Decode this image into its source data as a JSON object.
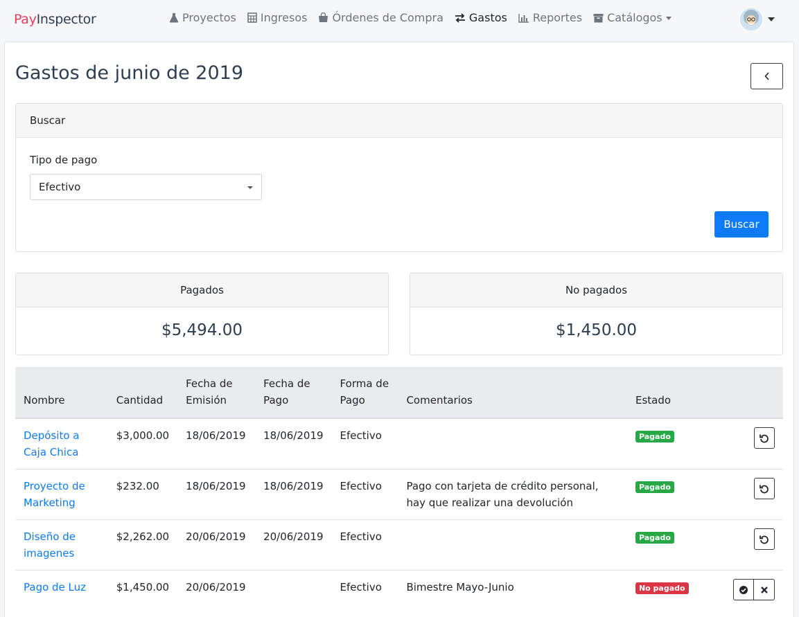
{
  "brand": {
    "part1": "Pay",
    "part2": "Inspector"
  },
  "nav": [
    {
      "label": "Proyectos",
      "icon": "flask-icon"
    },
    {
      "label": "Ingresos",
      "icon": "calculator-icon"
    },
    {
      "label": "Órdenes de Compra",
      "icon": "shopping-bag-icon"
    },
    {
      "label": "Gastos",
      "icon": "exchange-icon",
      "active": true
    },
    {
      "label": "Reportes",
      "icon": "bar-chart-icon"
    },
    {
      "label": "Catálogos",
      "icon": "archive-icon",
      "dropdown": true
    }
  ],
  "page": {
    "title": "Gastos de junio de 2019"
  },
  "search": {
    "header": "Buscar",
    "tipo_label": "Tipo de pago",
    "tipo_value": "Efectivo",
    "button": "Buscar"
  },
  "stats": {
    "paid": {
      "label": "Pagados",
      "value": "$5,494.00"
    },
    "unpaid": {
      "label": "No pagados",
      "value": "$1,450.00"
    }
  },
  "table": {
    "headers": {
      "nombre": "Nombre",
      "cantidad": "Cantidad",
      "emision": "Fecha de Emisión",
      "pago": "Fecha de Pago",
      "forma": "Forma de Pago",
      "comentarios": "Comentarios",
      "estado": "Estado"
    },
    "rows": [
      {
        "nombre": "Depósito a Caja Chica",
        "cantidad": "$3,000.00",
        "emision": "18/06/2019",
        "pago": "18/06/2019",
        "forma": "Efectivo",
        "comentarios": "",
        "estado": "Pagado"
      },
      {
        "nombre": "Proyecto de Marketing",
        "cantidad": "$232.00",
        "emision": "18/06/2019",
        "pago": "18/06/2019",
        "forma": "Efectivo",
        "comentarios": "Pago con tarjeta de crédito personal, hay que realizar una devolución",
        "estado": "Pagado"
      },
      {
        "nombre": "Diseño de imagenes",
        "cantidad": "$2,262.00",
        "emision": "20/06/2019",
        "pago": "20/06/2019",
        "forma": "Efectivo",
        "comentarios": "",
        "estado": "Pagado"
      },
      {
        "nombre": "Pago de Luz",
        "cantidad": "$1,450.00",
        "emision": "20/06/2019",
        "pago": "",
        "forma": "Efectivo",
        "comentarios": "Bimestre Mayo-Junio",
        "estado": "No pagado"
      }
    ]
  },
  "colors": {
    "primary": "#0d7bf7",
    "success": "#28a745",
    "danger": "#dc3545",
    "brand_accent": "#e83e5d"
  }
}
